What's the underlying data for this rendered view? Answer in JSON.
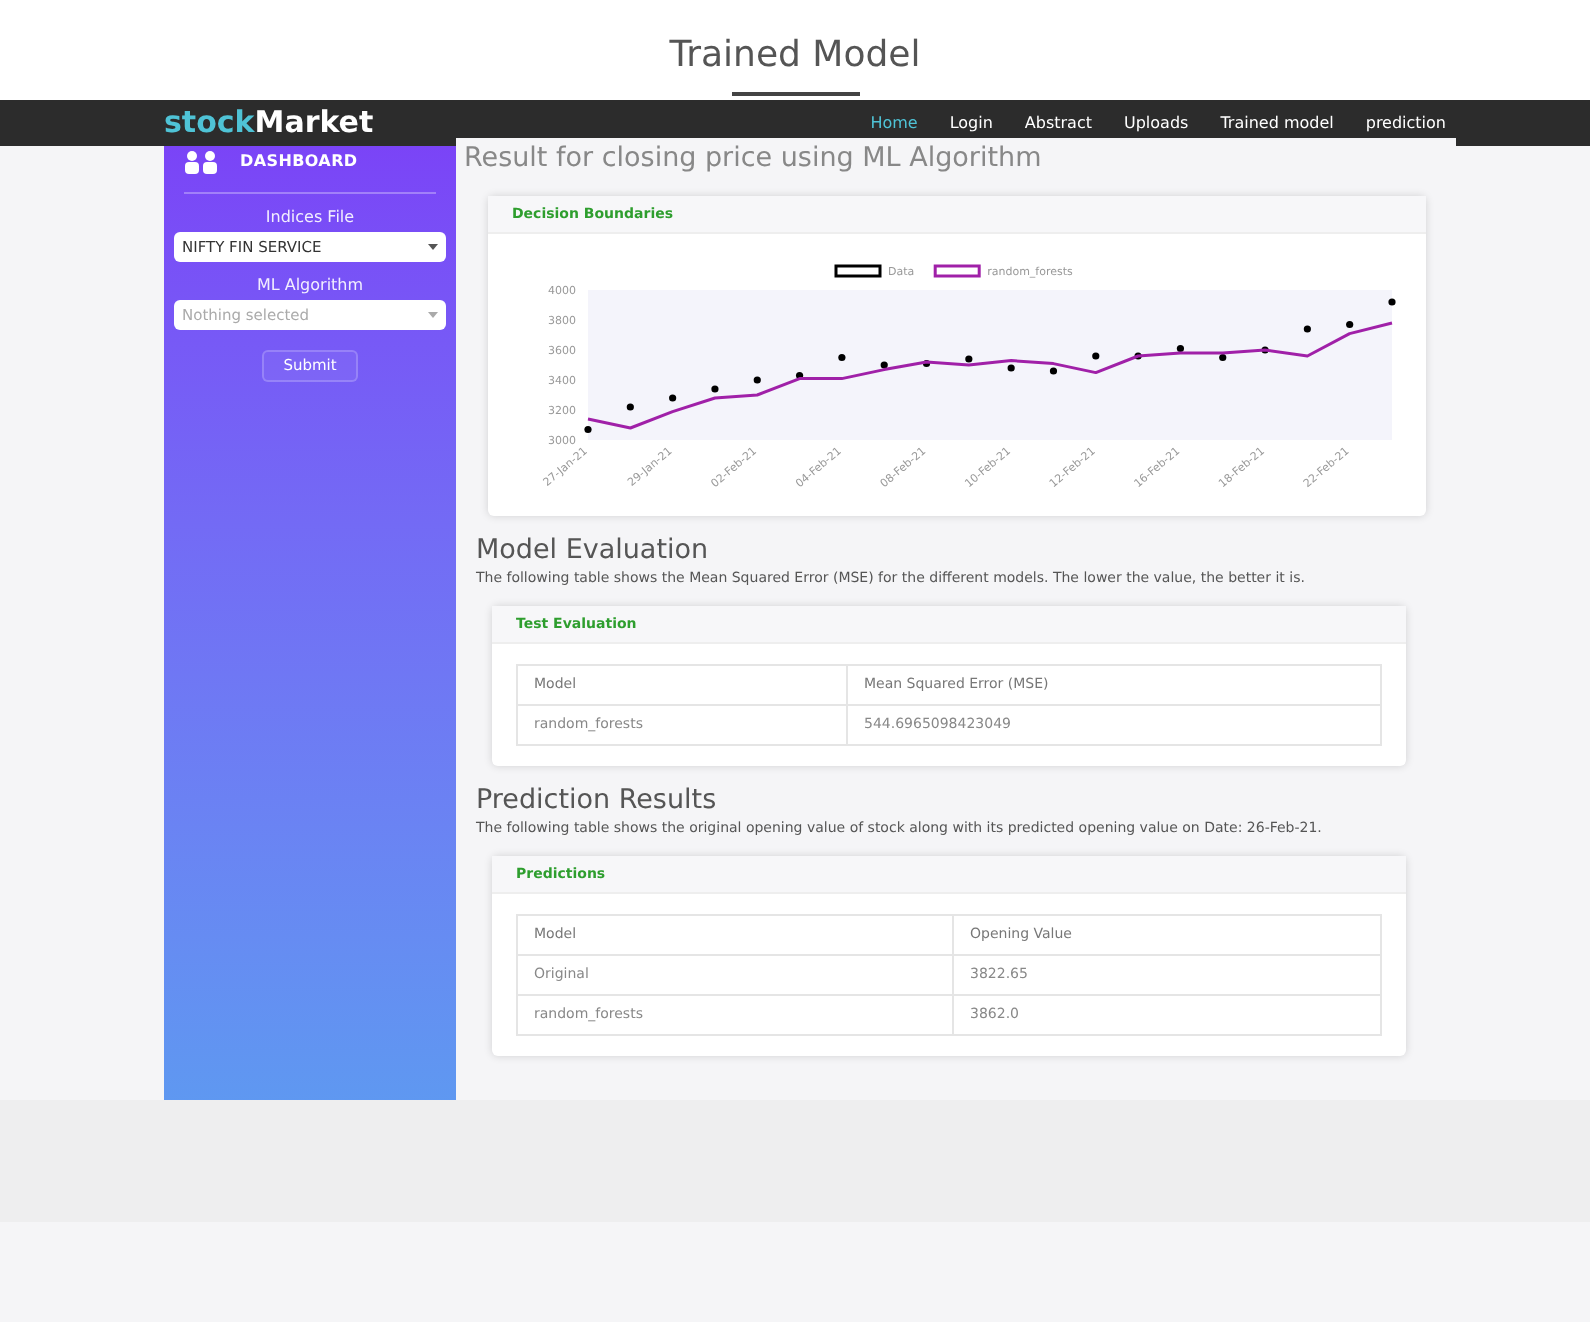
{
  "page_title": "Trained Model",
  "navbar": {
    "brand_part_1": "stock",
    "brand_part_2": "Market",
    "links": [
      {
        "label": "Home",
        "selected": true
      },
      {
        "label": "Login",
        "selected": false
      },
      {
        "label": "Abstract",
        "selected": false
      },
      {
        "label": "Uploads",
        "selected": false
      },
      {
        "label": "Trained model",
        "selected": false
      },
      {
        "label": "prediction",
        "selected": false
      }
    ]
  },
  "sidebar": {
    "title": "DASHBOARD",
    "fields": [
      {
        "label": "Indices File",
        "value": "NIFTY FIN SERVICE"
      },
      {
        "label": "ML Algorithm",
        "placeholder": "Nothing selected"
      }
    ],
    "submit": "Submit"
  },
  "heading": "Result for closing price using ML Algorithm",
  "chart_card": {
    "title": "Decision Boundaries",
    "chart_data": {
      "type": "line",
      "legend": "top",
      "categories": [
        "27-Jan-21",
        null,
        "29-Jan-21",
        null,
        "02-Feb-21",
        null,
        "04-Feb-21",
        null,
        "08-Feb-21",
        null,
        "10-Feb-21",
        null,
        "12-Feb-21",
        null,
        "16-Feb-21",
        null,
        "18-Feb-21",
        null,
        "22-Feb-21",
        null
      ],
      "ylim": [
        3000,
        4000
      ],
      "yticks": [
        3000,
        3200,
        3400,
        3600,
        3800,
        4000
      ],
      "series": [
        {
          "name": "Data",
          "color": "#000000",
          "type": "scatter",
          "values": [
            3070,
            3220,
            3280,
            3340,
            3400,
            3430,
            3550,
            3500,
            3510,
            3540,
            3480,
            3460,
            3560,
            3560,
            3610,
            3550,
            3600,
            3740,
            3770,
            3920
          ]
        },
        {
          "name": "random_forests",
          "color": "#a020a8",
          "type": "line",
          "values": [
            3140,
            3080,
            3190,
            3280,
            3300,
            3410,
            3410,
            3470,
            3520,
            3500,
            3530,
            3510,
            3450,
            3560,
            3580,
            3580,
            3600,
            3560,
            3710,
            3780
          ]
        }
      ]
    }
  },
  "sections": [
    {
      "heading": "Model Evaluation",
      "text": "The following table shows the Mean Squared Error (MSE) for the different models. The lower the value, the better it is.",
      "card_title": "Test Evaluation",
      "columns": [
        "Model",
        "Mean Squared Error (MSE)"
      ],
      "rows": [
        [
          "random_forests",
          "544.6965098423049"
        ]
      ]
    },
    {
      "heading": "Prediction Results",
      "text": "The following table shows the original opening value of stock along with its predicted opening value on Date: 26-Feb-21.",
      "card_title": "Predictions",
      "columns": [
        "Model",
        "Opening Value"
      ],
      "rows": [
        [
          "Original",
          "3822.65"
        ],
        [
          "random_forests",
          "3862.0"
        ]
      ]
    }
  ]
}
